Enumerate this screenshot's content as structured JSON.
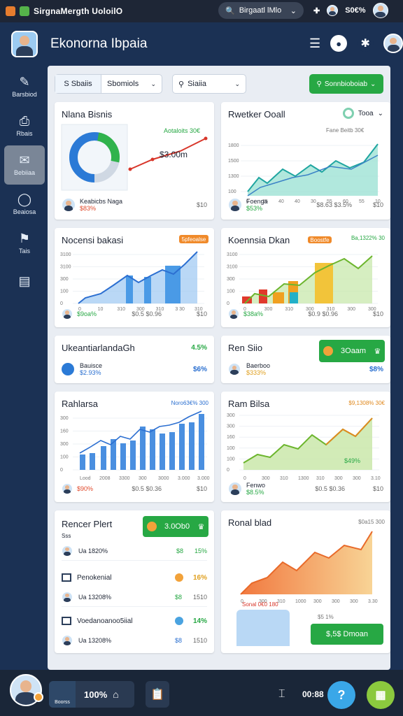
{
  "topbar": {
    "app_title": "SirgnaMergth UoloilO",
    "pill_label": "Birgaatl lMlo",
    "status_pct": "S0€%"
  },
  "header": {
    "title": "Ekonorna Ibpaia"
  },
  "sidebar": {
    "items": [
      {
        "label": "Barsbiod",
        "icon": "✎"
      },
      {
        "label": "Rbais",
        "icon": "⎙"
      },
      {
        "label": "Bebiiaa",
        "icon": "✉"
      },
      {
        "label": "Beaiosa",
        "icon": "◯"
      },
      {
        "label": "Tais",
        "icon": "⚑"
      },
      {
        "label": "",
        "icon": "▤"
      }
    ]
  },
  "filters": {
    "seg1": "S Sbaiis",
    "seg2": "Sbomiols",
    "search": "Siaiia",
    "action": "Sonnbioboiab"
  },
  "cards": {
    "c1": {
      "title": "Nlana Bisnis",
      "badge": "Aotaloits 30€",
      "value": "$3.00m",
      "name": "Keabicbs Naga",
      "pct": "$83%",
      "right": "$10"
    },
    "c2": {
      "title": "Rwetker Ooall",
      "dropdown": "Tooa",
      "tag": "Fane Beitb 30€",
      "name": "Foenga",
      "pct": "$53%",
      "mid": "$8.63 $3.5%",
      "right": "$10",
      "yt": [
        "1800",
        "1500",
        "1300",
        "100"
      ],
      "xt": [
        "0",
        "25",
        "40",
        "40",
        "30",
        "55",
        "60",
        "55",
        "10"
      ]
    },
    "c3": {
      "title": "Nocensi bakasi",
      "badge": "5pfeoalse",
      "pct": "$9oa%",
      "mid": "$0.5 $0.96",
      "right": "$10",
      "yt": [
        "3100",
        "3100",
        "300",
        "100",
        "0"
      ],
      "xt": [
        "0",
        "10",
        "310",
        "300",
        "310",
        "3 30",
        "310"
      ]
    },
    "c4": {
      "title": "Koennsia Dkan",
      "badge1": "Boostfe",
      "badge2": "Ba,1322% 30",
      "pct": "$38a%",
      "mid": "$0.9 $0.96",
      "right": "$10",
      "yt": [
        "3100",
        "3100",
        "300",
        "100",
        "0"
      ],
      "xt": [
        "0",
        "300",
        "310",
        "300",
        "310",
        "300",
        "300"
      ]
    },
    "c5": {
      "title": "UkeantiarlandaGh",
      "pct": "4.5%",
      "name": "Bauisce",
      "sub": "$2.93%",
      "right": "$6%"
    },
    "c6": {
      "title": "Ren Siio",
      "btn": "3Oaam",
      "name": "Baerboo",
      "sub": "$333%",
      "right": "$8%"
    },
    "c7": {
      "title": "Rahlarsa",
      "badge": "Noro63€% 300",
      "pct": "$90%",
      "mid": "$0.5 $0.36",
      "right": "$10",
      "yt": [
        "300",
        "160",
        "300",
        "100",
        "0"
      ],
      "xt": [
        "Lood",
        "2008",
        "3300",
        "300",
        "3000",
        "3.000",
        "3.000"
      ]
    },
    "c8": {
      "title": "Ram Bilsa",
      "badge": "$9,1308% 30€",
      "chart_label": "$49%",
      "name": "Fenwo",
      "pct": "$8.5%",
      "mid": "$0.5 $0.36",
      "right": "$10",
      "yt": [
        "300",
        "300",
        "160",
        "100",
        "100",
        "0"
      ],
      "xt": [
        "0",
        "300",
        "310",
        "1300",
        "310",
        "300",
        "300",
        "3.10"
      ]
    },
    "c9": {
      "title": "Rencer Plert",
      "btn": "3.0Ob0",
      "l1": "Sss",
      "rows": [
        {
          "label": "Ua 1820%",
          "val1": "$8",
          "val2": "15%"
        },
        {
          "label": "Penokenial",
          "val1": "",
          "val2": "16%"
        },
        {
          "label": "Ua 13208%",
          "val1": "$8",
          "val2": "1510"
        },
        {
          "label": "Voedanoanoo5iial",
          "val1": "",
          "val2": "14%"
        },
        {
          "label": "Ua 13208%",
          "val1": "$8",
          "val2": "1510"
        }
      ]
    },
    "c10": {
      "title": "Ronal blad",
      "badge": "$0a15 300",
      "sub": "Sonal 0€0 180",
      "sub2": "$5 1%",
      "btn": "$,5$ Dmoan",
      "xt": [
        "0",
        "300",
        "310",
        "1000",
        "300",
        "300",
        "300",
        "3.30"
      ]
    }
  },
  "bottombar": {
    "box_label": "100%",
    "box_sub": "Boorss",
    "code": "00:88"
  }
}
